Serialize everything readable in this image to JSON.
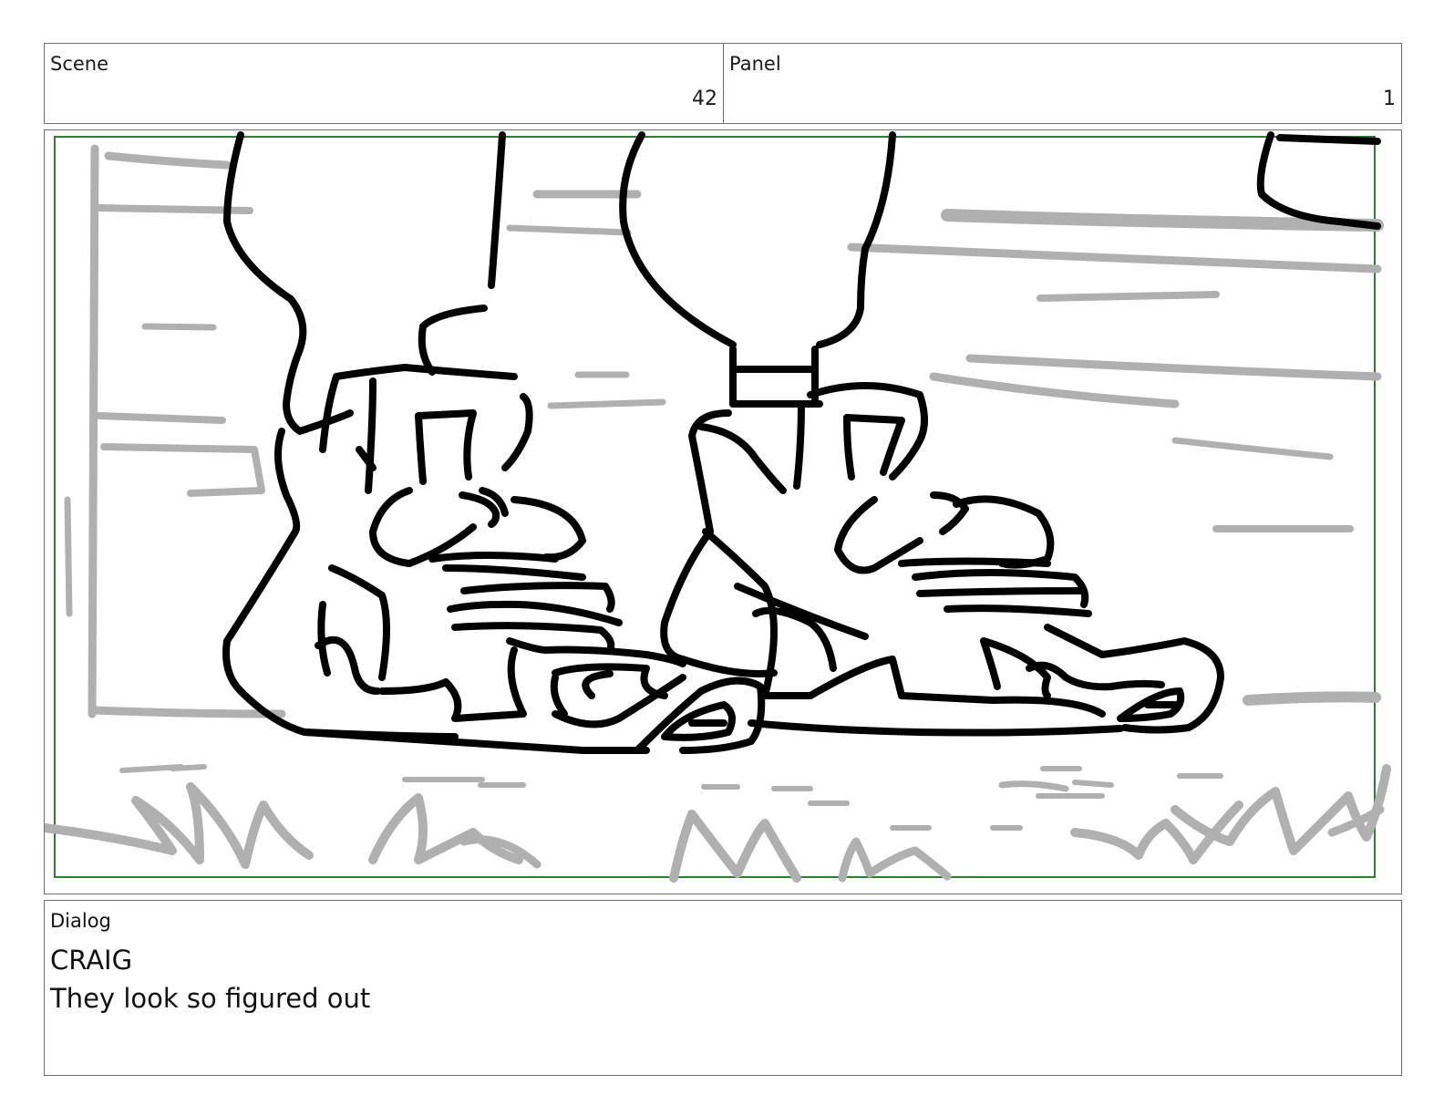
{
  "header": {
    "scene_label": "Scene",
    "scene_value": "42",
    "panel_label": "Panel",
    "panel_value": "1"
  },
  "frame": {
    "description_icon": "sketch-image",
    "safe_area_color": "#2e7d32",
    "ink_color": "#000000",
    "background_sketch_color": "#b0b0b0"
  },
  "dialog": {
    "label": "Dialog",
    "character": "CRAIG",
    "line": "They look so figured out"
  }
}
